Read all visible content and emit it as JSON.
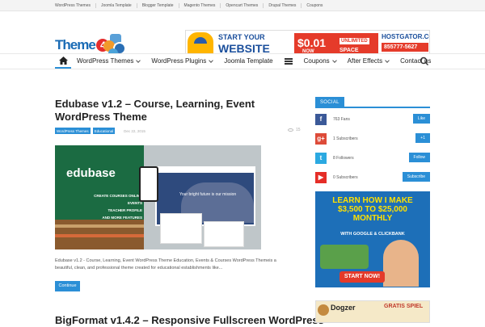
{
  "topbar": {
    "links": [
      "WordPress Themes",
      "Joomla Template",
      "Blogger Template",
      "Magento Themes",
      "Opencart Themes",
      "Drupal Themes",
      "Coupons"
    ]
  },
  "header": {
    "logo": {
      "left": "Theme",
      "four": "4",
      "right": "me"
    },
    "banner": {
      "line1": "START YOUR",
      "line2": "WEBSITE",
      "price": "$0.01",
      "now": "NOW",
      "unlimited": "UNLIMITED",
      "space": "SPACE",
      "brand": "HOSTGATOR.COM",
      "phone": "855777-5627"
    }
  },
  "nav": {
    "items": [
      {
        "label": "WordPress Themes",
        "dropdown": true
      },
      {
        "label": "WordPress Plugins",
        "dropdown": true
      },
      {
        "label": "Joomla Template",
        "dropdown": false
      },
      {
        "label": "Coupons",
        "dropdown": true
      },
      {
        "label": "After Effects",
        "dropdown": true
      },
      {
        "label": "Contact us",
        "dropdown": false
      }
    ]
  },
  "post": {
    "title": "Edubase v1.2 – Course, Learning, Event WordPress Theme",
    "tags": [
      "WordPress Themes",
      "Educational"
    ],
    "date": "Dec 22, 2015",
    "views": "15",
    "image": {
      "brand": "edubase",
      "features": [
        "CREATE COURSES ONLINE",
        "EVENTS",
        "TEACHER PROFILE",
        "AND MORE FEATURES"
      ],
      "caption": "Your bright future is our mission"
    },
    "excerpt": "Edubase v1.2 - Course, Learning, Event WordPress Theme Education, Events & Courses WordPress Themeis a beautiful, clean, and professional theme created for educational establishments like...",
    "continue_label": "Continue"
  },
  "post2": {
    "title": "BigFormat v1.4.2 – Responsive Fullscreen WordPress"
  },
  "sidebar": {
    "social_heading": "SOCIAL",
    "social": [
      {
        "icon": "f",
        "color": "#3b5998",
        "text": "763 Fans",
        "button": "Like"
      },
      {
        "icon": "g+",
        "color": "#dd4b39",
        "text": "1 Subscribers",
        "button": "+1"
      },
      {
        "icon": "t",
        "color": "#2ba9e1",
        "text": "8 Followers",
        "button": "Follow"
      },
      {
        "icon": "▶",
        "color": "#e52d27",
        "text": "0 Subscribers",
        "button": "Subscribe"
      }
    ],
    "ad1": {
      "line1": "LEARN HOW I MAKE",
      "line2": "$3,500 TO $25,000",
      "line3": "MONTHLY",
      "line4": "WITH GOOGLE & CLICKBANK",
      "cta": "START NOW!"
    },
    "ad2": {
      "brand": "Dogzer",
      "tagline": "GRATIS SPIEL"
    }
  },
  "colors": {
    "accent": "#2b8fd6"
  }
}
